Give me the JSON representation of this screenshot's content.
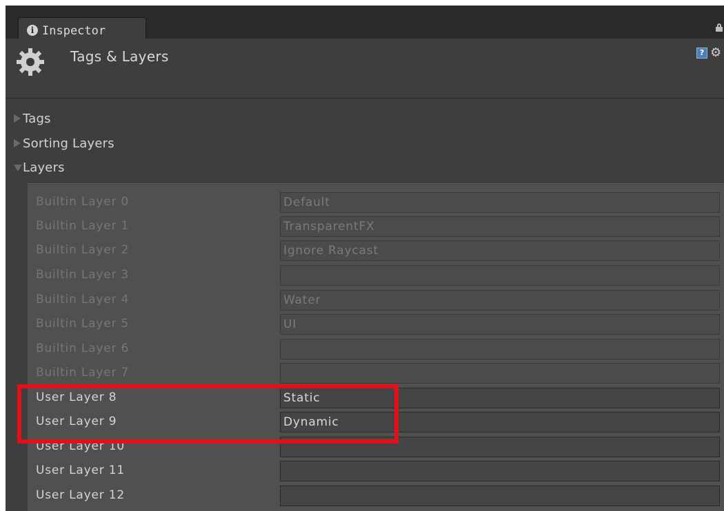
{
  "window": {
    "tab_label": "Inspector"
  },
  "header": {
    "title": "Tags & Layers",
    "help_glyph": "?"
  },
  "sections": [
    {
      "label": "Tags",
      "expanded": false
    },
    {
      "label": "Sorting Layers",
      "expanded": false
    },
    {
      "label": "Layers",
      "expanded": true
    }
  ],
  "layers": [
    {
      "label": "Builtin Layer 0",
      "value": "Default",
      "builtin": true
    },
    {
      "label": "Builtin Layer 1",
      "value": "TransparentFX",
      "builtin": true
    },
    {
      "label": "Builtin Layer 2",
      "value": "Ignore Raycast",
      "builtin": true
    },
    {
      "label": "Builtin Layer 3",
      "value": "",
      "builtin": true
    },
    {
      "label": "Builtin Layer 4",
      "value": "Water",
      "builtin": true
    },
    {
      "label": "Builtin Layer 5",
      "value": "UI",
      "builtin": true
    },
    {
      "label": "Builtin Layer 6",
      "value": "",
      "builtin": true
    },
    {
      "label": "Builtin Layer 7",
      "value": "",
      "builtin": true
    },
    {
      "label": "User Layer 8",
      "value": "Static",
      "builtin": false
    },
    {
      "label": "User Layer 9",
      "value": "Dynamic",
      "builtin": false
    },
    {
      "label": "User Layer 10",
      "value": "",
      "builtin": false
    },
    {
      "label": "User Layer 11",
      "value": "",
      "builtin": false
    },
    {
      "label": "User Layer 12",
      "value": "",
      "builtin": false
    }
  ],
  "colors": {
    "highlight": "#e3101a",
    "panel_bg": "#3e3e3e",
    "layers_bg": "#505050"
  }
}
